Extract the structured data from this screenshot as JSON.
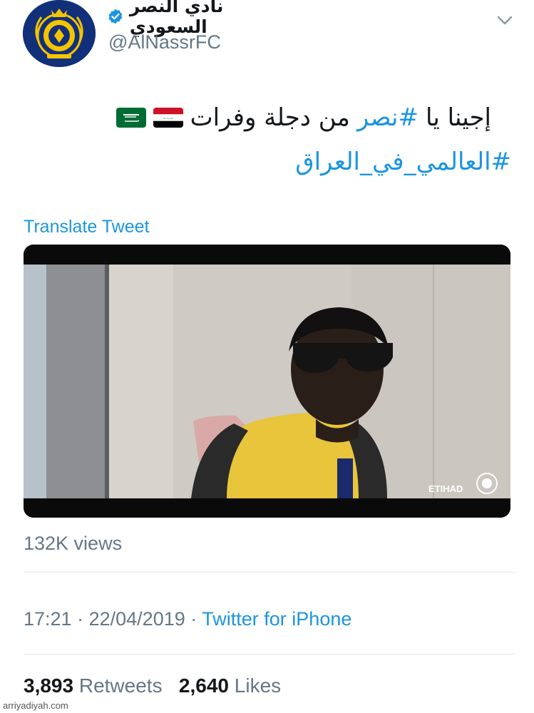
{
  "header": {
    "display_name": "نادي النصر السعودي",
    "handle": "@AlNassrFC",
    "avatar_icon": "al-nassr-crest-icon",
    "verified_icon": "verified-badge-icon",
    "more_icon": "chevron-down-icon"
  },
  "tweet": {
    "line1_prefix": "إجينا يا ",
    "line1_hashtag": "#نصر",
    "line1_suffix": " من دجلة وفرات",
    "flags": [
      "iraq-flag-icon",
      "saudi-flag-icon"
    ],
    "line2_hashtag": "#العالمي_في_العراق",
    "translate_label": "Translate Tweet"
  },
  "media": {
    "type": "video",
    "watermark_text": "ETIHAD"
  },
  "stats": {
    "views": "132K views",
    "time": "17:21",
    "separator": "·",
    "date": "22/04/2019",
    "source": "Twitter for iPhone",
    "retweets_count": "3,893",
    "retweets_label": "Retweets",
    "likes_count": "2,640",
    "likes_label": "Likes"
  },
  "site_watermark": "arriyadiyah.com",
  "colors": {
    "link": "#1b95e0",
    "muted": "#657786",
    "text": "#14171a",
    "divider": "#e1e8ed",
    "club_blue": "#12307a",
    "club_yellow": "#f5c400"
  }
}
